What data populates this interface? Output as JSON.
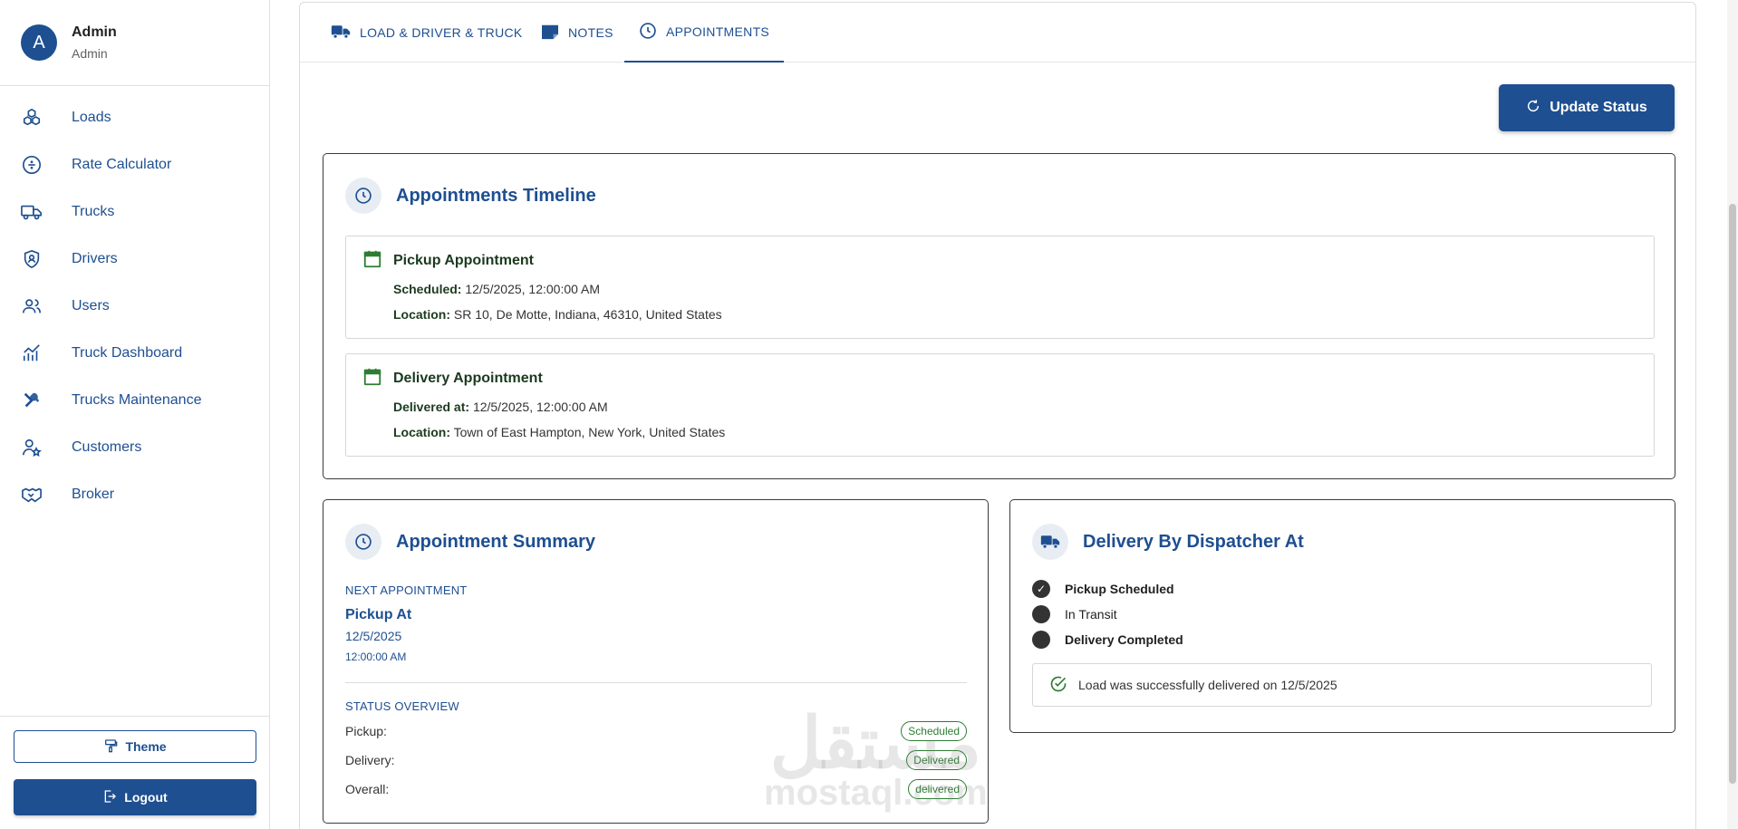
{
  "user": {
    "initial": "A",
    "name": "Admin",
    "role": "Admin"
  },
  "sidebar": {
    "items": [
      {
        "label": "Loads",
        "icon": "cubes-icon"
      },
      {
        "label": "Rate Calculator",
        "icon": "divide-icon"
      },
      {
        "label": "Trucks",
        "icon": "truck-icon"
      },
      {
        "label": "Drivers",
        "icon": "shield-user-icon"
      },
      {
        "label": "Users",
        "icon": "users-icon"
      },
      {
        "label": "Truck Dashboard",
        "icon": "chart-line-icon"
      },
      {
        "label": "Trucks Maintenance",
        "icon": "tools-icon"
      },
      {
        "label": "Customers",
        "icon": "user-star-icon"
      },
      {
        "label": "Broker",
        "icon": "handshake-icon"
      }
    ],
    "theme_label": "Theme",
    "logout_label": "Logout"
  },
  "tabs": [
    {
      "label": "LOAD & DRIVER & TRUCK",
      "icon": "truck-icon"
    },
    {
      "label": "NOTES",
      "icon": "note-icon"
    },
    {
      "label": "APPOINTMENTS",
      "icon": "clock-icon",
      "active": true
    }
  ],
  "actions": {
    "update_status_label": "Update Status"
  },
  "timeline": {
    "title": "Appointments Timeline",
    "pickup": {
      "title": "Pickup Appointment",
      "scheduled_label": "Scheduled:",
      "scheduled_value": "12/5/2025, 12:00:00 AM",
      "location_label": "Location:",
      "location_value": "SR 10, De Motte, Indiana, 46310, United States"
    },
    "delivery": {
      "title": "Delivery Appointment",
      "delivered_label": "Delivered at:",
      "delivered_value": "12/5/2025, 12:00:00 AM",
      "location_label": "Location:",
      "location_value": "Town of East Hampton, New York, United States"
    }
  },
  "summary": {
    "title": "Appointment Summary",
    "next_label": "NEXT APPOINTMENT",
    "next_title": "Pickup At",
    "next_date": "12/5/2025",
    "next_time": "12:00:00 AM",
    "status_label": "STATUS OVERVIEW",
    "rows": [
      {
        "label": "Pickup:",
        "badge": "Scheduled"
      },
      {
        "label": "Delivery:",
        "badge": "Delivered"
      },
      {
        "label": "Overall:",
        "badge": "delivered"
      }
    ]
  },
  "dispatcher": {
    "title": "Delivery By Dispatcher At",
    "steps": [
      {
        "label": "Pickup Scheduled",
        "checked": true
      },
      {
        "label": "In Transit",
        "checked": false
      },
      {
        "label": "Delivery Completed",
        "checked": false
      }
    ],
    "success_message": "Load was successfully delivered on 12/5/2025"
  },
  "watermark": {
    "arabic": "مستقل",
    "latin": "mostaql.com"
  },
  "colors": {
    "primary": "#1e4f91",
    "success": "#2e7d32"
  }
}
